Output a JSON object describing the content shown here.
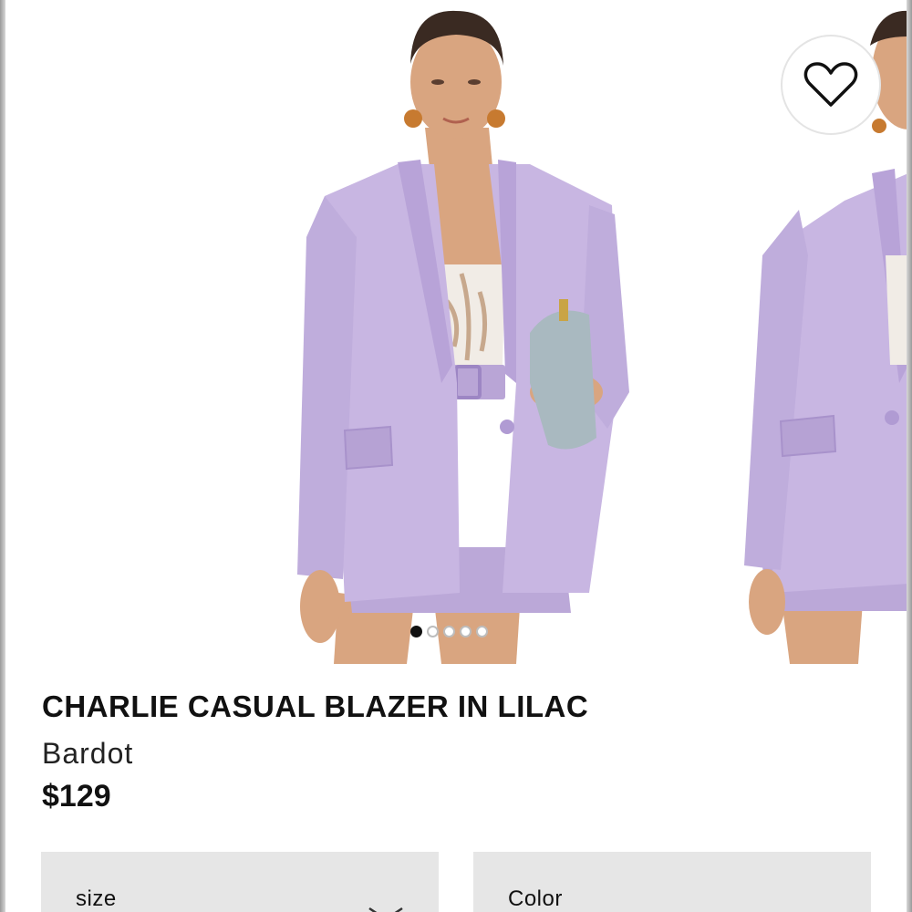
{
  "product": {
    "title": "CHARLIE CASUAL BLAZER IN LILAC",
    "brand": "Bardot",
    "price": "$129"
  },
  "gallery": {
    "image_count": 5,
    "active_index": 0
  },
  "selectors": {
    "size_label": "size",
    "color_label": "Color"
  },
  "colors": {
    "blazer": "#c8b6e2",
    "blazer_shadow": "#ad97cf",
    "skin": "#d9a580",
    "bag": "#a9b9c0",
    "text": "#111111",
    "select_bg": "#e6e6e6"
  },
  "icons": [
    "heart-icon",
    "chevron-down-icon"
  ]
}
